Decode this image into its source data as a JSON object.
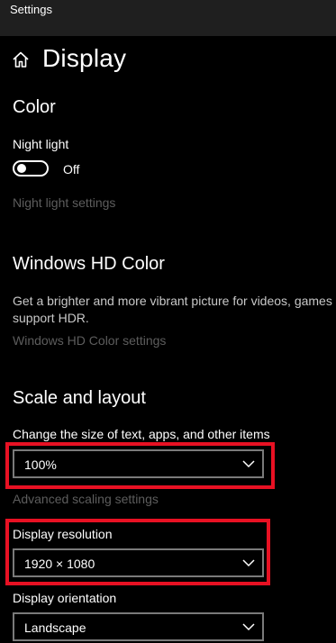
{
  "window": {
    "title": "Settings"
  },
  "header": {
    "title": "Display",
    "home_icon": "home-icon"
  },
  "color_section": {
    "heading": "Color",
    "night_light_label": "Night light",
    "night_light_state": "Off",
    "night_light_on": false,
    "night_light_settings_link": "Night light settings"
  },
  "hd_color_section": {
    "heading": "Windows HD Color",
    "description_line1": "Get a brighter and more vibrant picture for videos, games",
    "description_line2": "support HDR.",
    "settings_link": "Windows HD Color settings"
  },
  "scale_section": {
    "heading": "Scale and layout",
    "scale_label": "Change the size of text, apps, and other items",
    "scale_value": "100%",
    "advanced_scaling_link": "Advanced scaling settings",
    "resolution_label": "Display resolution",
    "resolution_value": "1920 × 1080",
    "orientation_label": "Display orientation",
    "orientation_value": "Landscape"
  },
  "colors": {
    "background": "#000000",
    "titlebar": "#1f1f1f",
    "highlight": "#e81123",
    "disabled_text": "#5d5d5d",
    "dropdown_border": "#7a7a7a"
  }
}
